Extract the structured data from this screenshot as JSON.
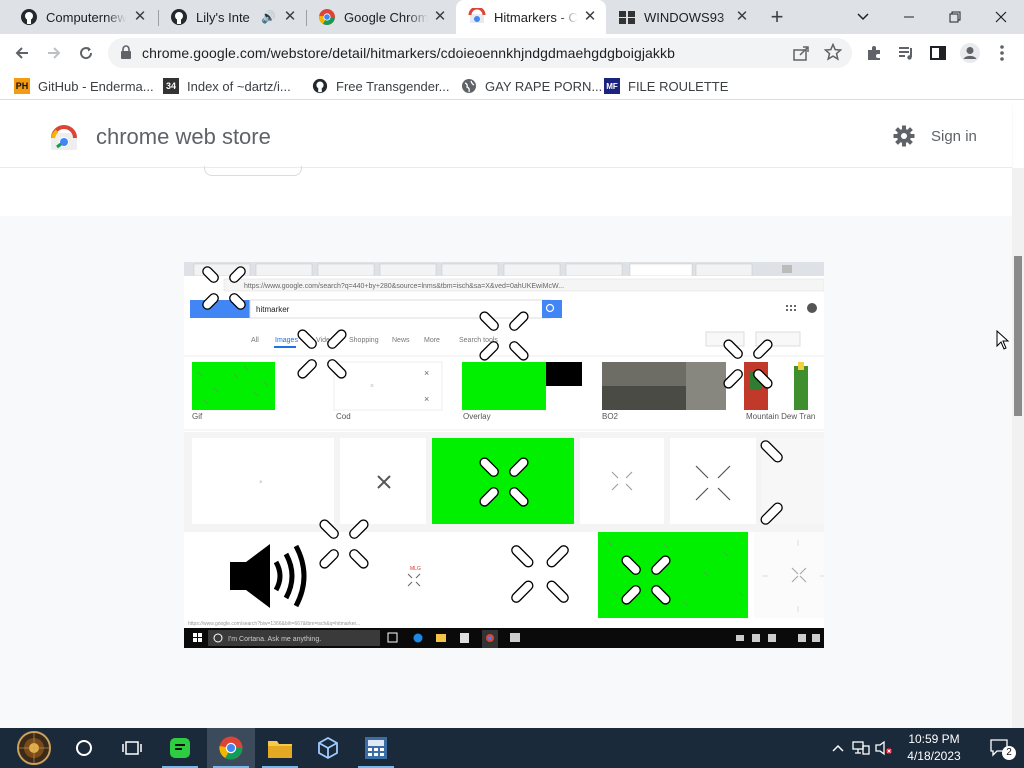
{
  "browser": {
    "tabs": [
      {
        "title": "Computernewb",
        "icon": "github-icon"
      },
      {
        "title": "Lily's Inte",
        "icon": "github-icon",
        "audio": true
      },
      {
        "title": "Google Chrome",
        "icon": "chrome-icon"
      },
      {
        "title": "Hitmarkers - C",
        "icon": "chrome-web-store-icon",
        "active": true
      },
      {
        "title": "WINDOWS93",
        "icon": "windows93-icon"
      }
    ],
    "url": "chrome.google.com/webstore/detail/hitmarkers/cdoieoennkhjndgdmaehgdgboigjakkb",
    "bookmarks": [
      {
        "label": "GitHub - Enderma...",
        "icon": "ph-icon",
        "icon_text": "PH"
      },
      {
        "label": "Index of ~dartz/i...",
        "icon": "folder-page-icon",
        "icon_text": "34"
      },
      {
        "label": "Free Transgender...",
        "icon": "github-icon"
      },
      {
        "label": "GAY RAPE PORN...",
        "icon": "globe-icon"
      },
      {
        "label": "FILE ROULETTE",
        "icon": "mf-icon",
        "icon_text": "MF"
      }
    ]
  },
  "store": {
    "title": "chrome web store",
    "sign_in": "Sign in"
  },
  "screenshot": {
    "url_text": "https://www.google.com/search?q=440+by+280&source=lnms&tbm=isch&sa=X&ved=0ahUKEwiMcW...",
    "search_text": "hitmarker",
    "filters": [
      "All",
      "Images",
      "Videos",
      "Shopping",
      "News",
      "More",
      "Search tools"
    ],
    "chips": [
      "Gif",
      "Cod",
      "Overlay",
      "BO2",
      "Mountain Dew Tran"
    ],
    "cortana": "I'm Cortana. Ask me anything."
  },
  "taskbar": {
    "time": "10:59 PM",
    "date": "4/18/2023",
    "notification_count": "2"
  },
  "colors": {
    "tabstrip": "#dee1e6",
    "taskbar": "#1b2a3a",
    "green": "#00f000"
  }
}
